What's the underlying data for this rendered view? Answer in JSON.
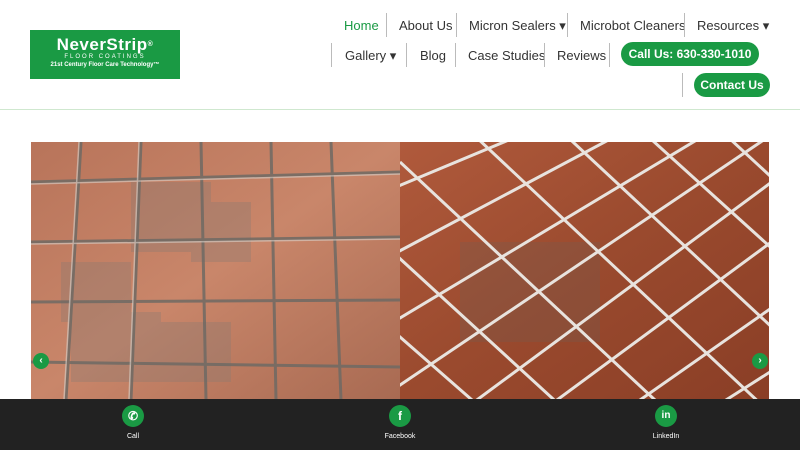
{
  "logo": {
    "brand": "NeverStrip",
    "registered": "®",
    "sub": "FLOOR COATINGS",
    "tagline": "21st Century Floor Care Technology™"
  },
  "nav": {
    "home": "Home",
    "about": "About Us",
    "micron_sealers": "Micron Sealers ▾",
    "microbot_cleaners": "Microbot Cleaners",
    "resources": "Resources ▾",
    "gallery": "Gallery ▾",
    "blog": "Blog",
    "case_studies": "Case Studies",
    "reviews": "Reviews",
    "call": "Call Us: 630-330-1010",
    "contact": "Contact Us"
  },
  "slider": {
    "prev_icon": "chevron-left-icon",
    "next_icon": "chevron-right-icon",
    "prev_glyph": "‹",
    "next_glyph": "›"
  },
  "bottombar": {
    "items": [
      {
        "label": "Call",
        "icon": "phone-icon",
        "glyph": "✆"
      },
      {
        "label": "Facebook",
        "icon": "facebook-icon",
        "glyph": "f"
      },
      {
        "label": "LinkedIn",
        "icon": "linkedin-icon",
        "glyph": "in"
      }
    ]
  },
  "colors": {
    "brand_green": "#1a9a44",
    "bottom_bar": "#222222"
  }
}
